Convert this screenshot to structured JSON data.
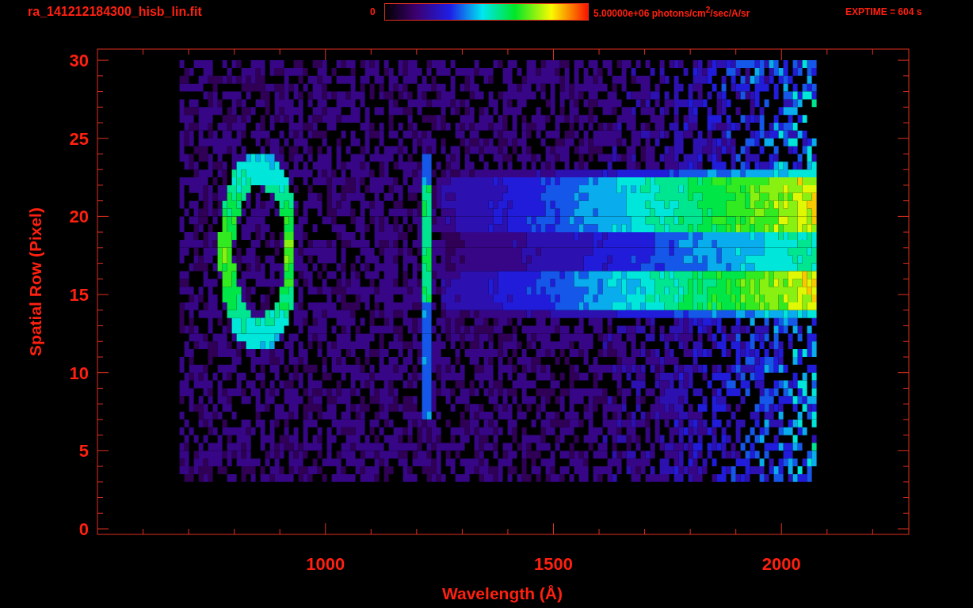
{
  "title": "ra_141212184300_hisb_lin.fit",
  "color_scale": {
    "min_label": "0",
    "max_label": "5.00000e+06 photons/cm$^{2}$/sec/A/sr"
  },
  "exposure": "EXPTIME = 604 s",
  "plot": {
    "xlabel": "Wavelength (Å)",
    "ylabel": "Spatial Row (Pixel)",
    "xticks": [
      "1000",
      "1500",
      "2000"
    ],
    "yticks": [
      "30",
      "25",
      "20",
      "15",
      "10",
      "5",
      "0"
    ]
  }
}
